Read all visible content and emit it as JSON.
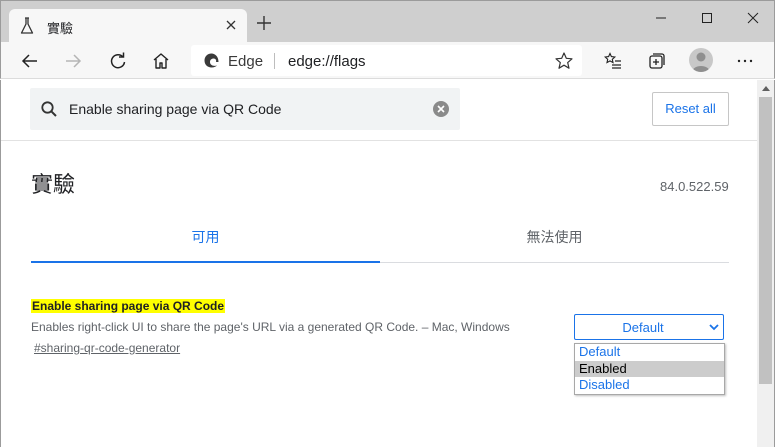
{
  "window": {
    "tab_title": "實驗",
    "controls": [
      "minimize",
      "maximize",
      "close"
    ]
  },
  "toolbar": {
    "browser_name": "Edge",
    "url": "edge://flags"
  },
  "search": {
    "value": "Enable sharing page via QR Code"
  },
  "reset_label": "Reset all",
  "page": {
    "title": "實驗",
    "version": "84.0.522.59"
  },
  "tabs": [
    {
      "label": "可用",
      "active": true
    },
    {
      "label": "無法使用",
      "active": false
    }
  ],
  "flag": {
    "name": "Enable sharing page via QR Code",
    "description": "Enables right-click UI to share the page's URL via a generated QR Code. – Mac, Windows",
    "link": "#sharing-qr-code-generator",
    "selected": "Default",
    "options": [
      "Default",
      "Enabled",
      "Disabled"
    ],
    "highlighted_option": "Enabled"
  },
  "colors": {
    "accent": "#1a73e8",
    "search_highlight": "#ffff00",
    "titlebar": "#cfcfcf"
  }
}
